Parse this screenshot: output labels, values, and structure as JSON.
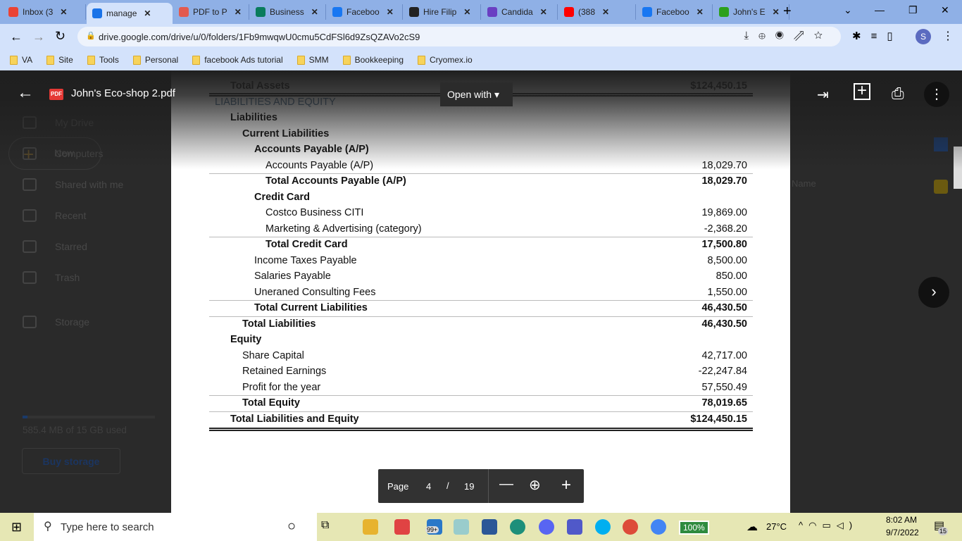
{
  "browser": {
    "tabs": [
      {
        "label": "Inbox (3",
        "color": "#ea4335"
      },
      {
        "label": "manage",
        "color": "#1a73e8",
        "active": true
      },
      {
        "label": "PDF to P",
        "color": "#e35a4f"
      },
      {
        "label": "Business",
        "color": "#0a7c5c"
      },
      {
        "label": "Faceboo",
        "color": "#1877f2"
      },
      {
        "label": "Hire Filip",
        "color": "#222"
      },
      {
        "label": "Candida",
        "color": "#6a3fc2"
      },
      {
        "label": "(388",
        "color": "#ff0000"
      },
      {
        "label": "Faceboo",
        "color": "#1877f2"
      },
      {
        "label": "John's E",
        "color": "#2ca01c"
      }
    ],
    "new_tab": "+",
    "url": "drive.google.com/drive/u/0/folders/1Fb9mwqwU0cmu5CdFSl6d9ZsQZAVo2cS9",
    "profile_initial": "S",
    "bookmarks": [
      "VA",
      "Site",
      "Tools",
      "Personal",
      "facebook Ads tutorial",
      "SMM",
      "Bookkeeping",
      "Cryomex.io"
    ]
  },
  "drive": {
    "new_label": "New",
    "nav": [
      "My Drive",
      "Computers",
      "Shared with me",
      "Recent",
      "Starred",
      "Trash",
      "Storage"
    ],
    "storage_used": "585.4 MB of 15 GB used",
    "storage_fraction": 0.039,
    "buy_storage": "Buy storage",
    "sort_label": "Name"
  },
  "viewer": {
    "file_name": "John's Eco-shop 2.pdf",
    "file_badge": "PDF",
    "open_with": "Open with",
    "page_label": "Page",
    "current_page": "4",
    "page_sep": "/",
    "total_pages": "19"
  },
  "report": {
    "rows": [
      {
        "label": "Total Assets",
        "value": "$124,450.15",
        "level": 1,
        "bold": true
      },
      {
        "label": "LIABILITIES AND EQUITY",
        "value": "",
        "level": 0,
        "heading": true
      },
      {
        "label": "Liabilities",
        "value": "",
        "level": 1,
        "bold": true
      },
      {
        "label": "Current Liabilities",
        "value": "",
        "level": 2,
        "bold": true
      },
      {
        "label": "Accounts Payable (A/P)",
        "value": "",
        "level": 3,
        "bold": true
      },
      {
        "label": "Accounts Payable (A/P)",
        "value": "18,029.70",
        "level": 4
      },
      {
        "label": "Total Accounts Payable (A/P)",
        "value": "18,029.70",
        "level": 4,
        "bold": true,
        "line": true
      },
      {
        "label": "Credit Card",
        "value": "",
        "level": 3,
        "bold": true
      },
      {
        "label": "Costco Business CITI",
        "value": "19,869.00",
        "level": 4
      },
      {
        "label": "Marketing & Advertising (category)",
        "value": "-2,368.20",
        "level": 4
      },
      {
        "label": "Total Credit Card",
        "value": "17,500.80",
        "level": 4,
        "bold": true,
        "line": true
      },
      {
        "label": "Income Taxes Payable",
        "value": "8,500.00",
        "level": 3
      },
      {
        "label": "Salaries Payable",
        "value": "850.00",
        "level": 3
      },
      {
        "label": "Uneraned Consulting Fees",
        "value": "1,550.00",
        "level": 3
      },
      {
        "label": "Total Current Liabilities",
        "value": "46,430.50",
        "level": 3,
        "bold": true,
        "line": true
      },
      {
        "label": "Total Liabilities",
        "value": "46,430.50",
        "level": 2,
        "bold": true,
        "line": true
      },
      {
        "label": "Equity",
        "value": "",
        "level": 1,
        "bold": true
      },
      {
        "label": "Share Capital",
        "value": "42,717.00",
        "level": 2
      },
      {
        "label": "Retained Earnings",
        "value": "-22,247.84",
        "level": 2
      },
      {
        "label": "Profit for the year",
        "value": "57,550.49",
        "level": 2
      },
      {
        "label": "Total Equity",
        "value": "78,019.65",
        "level": 2,
        "bold": true,
        "line": true
      },
      {
        "label": "Total Liabilities and Equity",
        "value": "$124,450.15",
        "level": 1,
        "bold": true,
        "line": true
      }
    ]
  },
  "taskbar": {
    "search_placeholder": "Type here to search",
    "mail_badge": "99+",
    "battery": "100%",
    "temperature": "27°C",
    "time": "8:02 AM",
    "date": "9/7/2022",
    "notifications": "15"
  },
  "colors": {
    "heading": "#4a6b8a",
    "accent": "#1a73e8"
  }
}
